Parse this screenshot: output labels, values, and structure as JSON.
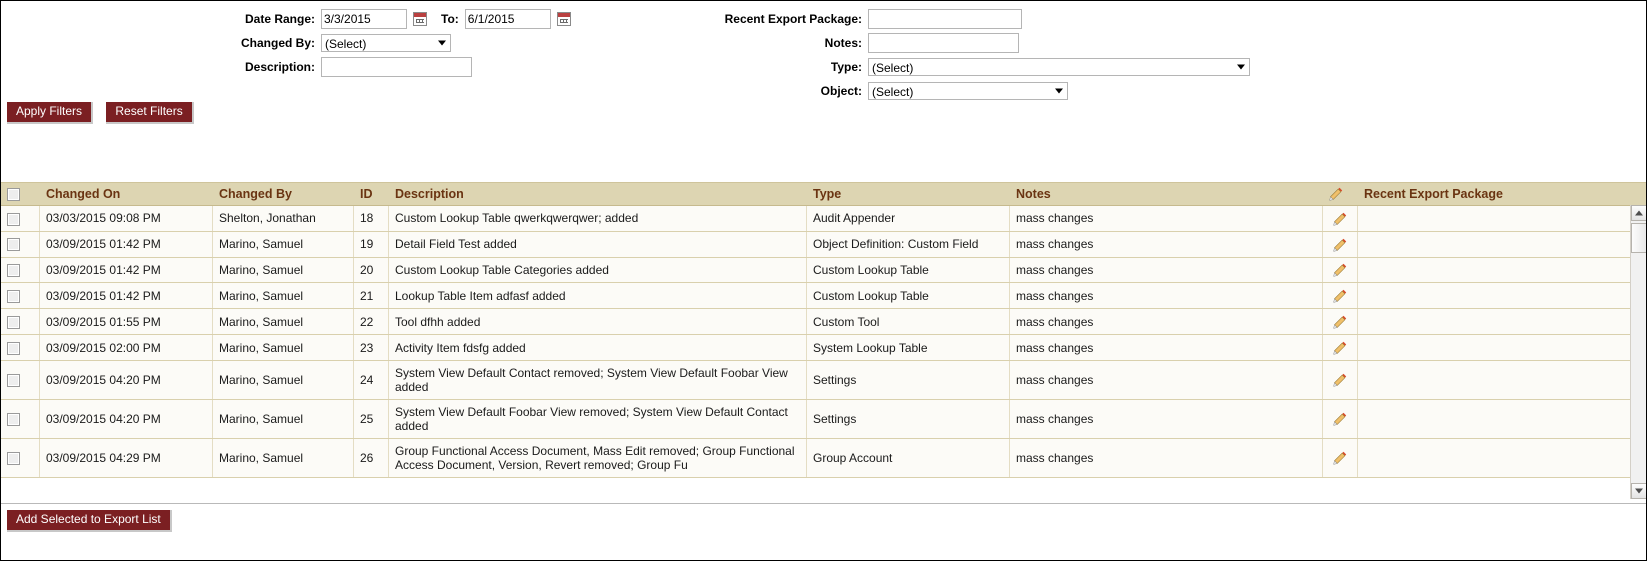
{
  "filters": {
    "date_range_label": "Date Range:",
    "date_from_value": "3/3/2015",
    "to_label": "To:",
    "date_to_value": "6/1/2015",
    "changed_by_label": "Changed By:",
    "changed_by_value": "(Select)",
    "description_label": "Description:",
    "description_value": "",
    "recent_export_package_label": "Recent Export Package:",
    "recent_export_package_value": "",
    "notes_label": "Notes:",
    "notes_value": "",
    "type_label": "Type:",
    "type_value": "(Select)",
    "object_label": "Object:",
    "object_value": "(Select)"
  },
  "buttons": {
    "apply_filters": "Apply Filters",
    "reset_filters": "Reset Filters",
    "add_selected_to_export_list": "Add Selected to Export List"
  },
  "grid": {
    "columns": {
      "changed_on": "Changed On",
      "changed_by": "Changed By",
      "id": "ID",
      "description": "Description",
      "type": "Type",
      "notes": "Notes",
      "recent_export_package": "Recent Export Package"
    },
    "rows": [
      {
        "changed_on": "03/03/2015 09:08 PM",
        "changed_by": "Shelton, Jonathan",
        "id": "18",
        "description": "Custom Lookup Table qwerkqwerqwer; added",
        "type": "Audit Appender",
        "notes": "mass changes",
        "recent_export_package": ""
      },
      {
        "changed_on": "03/09/2015 01:42 PM",
        "changed_by": "Marino, Samuel",
        "id": "19",
        "description": "Detail Field Test added",
        "type": "Object Definition: Custom Field",
        "notes": "mass changes",
        "recent_export_package": ""
      },
      {
        "changed_on": "03/09/2015 01:42 PM",
        "changed_by": "Marino, Samuel",
        "id": "20",
        "description": "Custom Lookup Table Categories added",
        "type": "Custom Lookup Table",
        "notes": "mass changes",
        "recent_export_package": ""
      },
      {
        "changed_on": "03/09/2015 01:42 PM",
        "changed_by": "Marino, Samuel",
        "id": "21",
        "description": "Lookup Table Item adfasf added",
        "type": "Custom Lookup Table",
        "notes": "mass changes",
        "recent_export_package": ""
      },
      {
        "changed_on": "03/09/2015 01:55 PM",
        "changed_by": "Marino, Samuel",
        "id": "22",
        "description": "Tool dfhh added",
        "type": "Custom Tool",
        "notes": "mass changes",
        "recent_export_package": ""
      },
      {
        "changed_on": "03/09/2015 02:00 PM",
        "changed_by": "Marino, Samuel",
        "id": "23",
        "description": "Activity Item fdsfg added",
        "type": "System Lookup Table",
        "notes": "mass changes",
        "recent_export_package": ""
      },
      {
        "changed_on": "03/09/2015 04:20 PM",
        "changed_by": "Marino, Samuel",
        "id": "24",
        "description": "System View Default Contact removed; System View Default Foobar View added",
        "type": "Settings",
        "notes": "mass changes",
        "recent_export_package": ""
      },
      {
        "changed_on": "03/09/2015 04:20 PM",
        "changed_by": "Marino, Samuel",
        "id": "25",
        "description": "System View Default Foobar View removed; System View Default Contact added",
        "type": "Settings",
        "notes": "mass changes",
        "recent_export_package": ""
      },
      {
        "changed_on": "03/09/2015 04:29 PM",
        "changed_by": "Marino, Samuel",
        "id": "26",
        "description": "Group Functional Access Document, Mass Edit removed; Group Functional Access Document, Version, Revert removed; Group Fu",
        "type": "Group Account",
        "notes": "mass changes",
        "recent_export_package": ""
      }
    ]
  },
  "colors": {
    "accent": "#7b1f22",
    "header_bg": "#ddd5b2",
    "header_text": "#6a3412",
    "row_bg": "#fcfbf7",
    "row_border": "#d9d0ad"
  }
}
